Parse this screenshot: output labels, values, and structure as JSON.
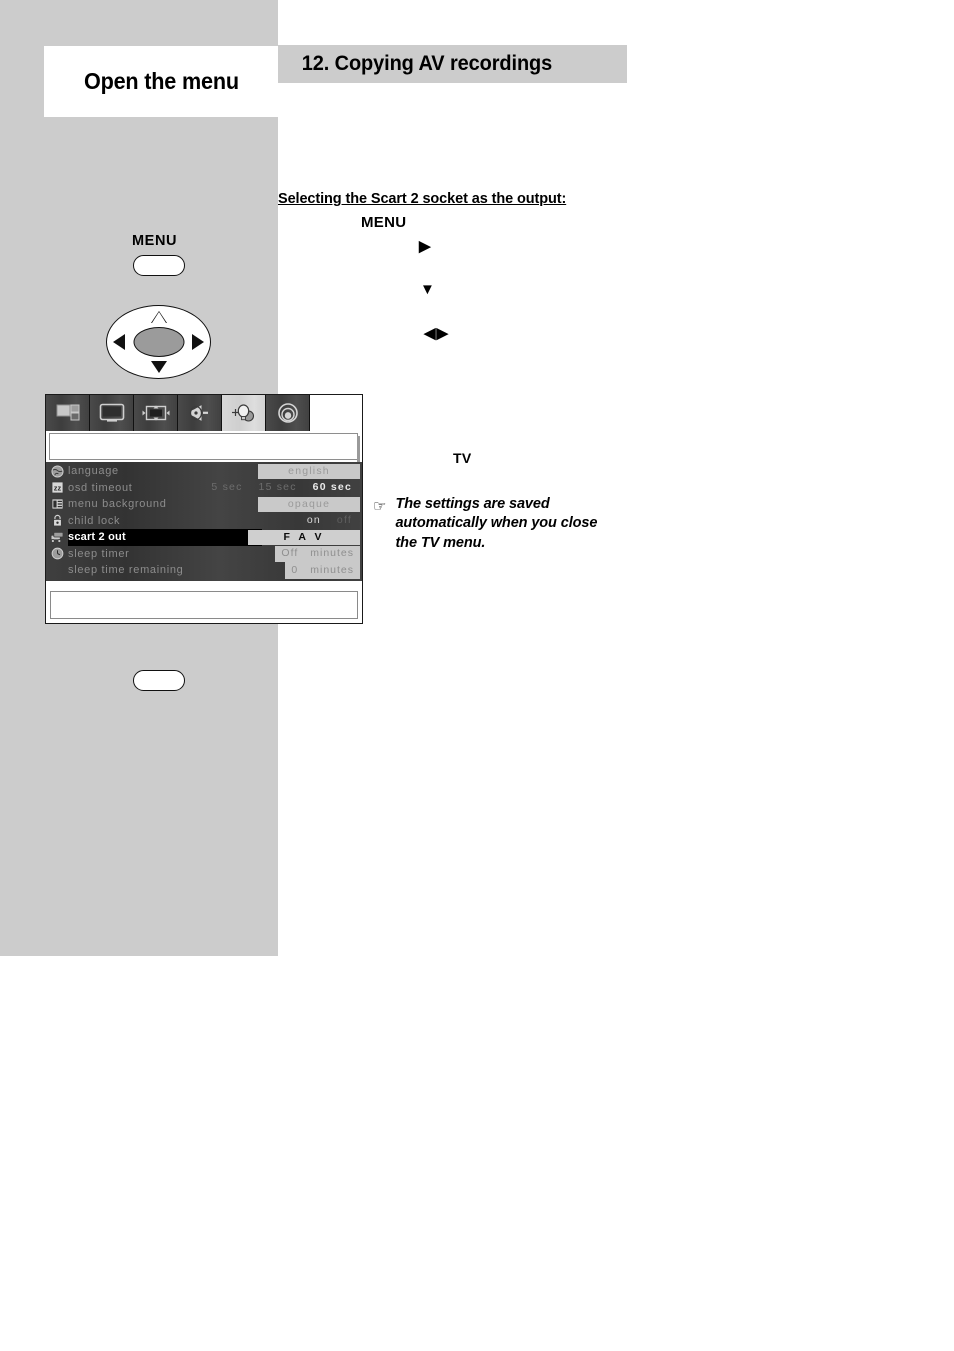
{
  "page": {
    "section_title": "Open the menu",
    "chapter_title": "12. Copying AV recordings"
  },
  "instructions": {
    "heading": "Selecting the Scart 2 socket as the output:",
    "steps": [
      {
        "key": "menu-step",
        "label": "MENU"
      },
      {
        "key": "right-step",
        "label": "▶"
      },
      {
        "key": "down-step",
        "label": "▼"
      },
      {
        "key": "left-right-step",
        "label": "◀▶"
      },
      {
        "key": "tv-step",
        "label": "TV"
      }
    ],
    "note": {
      "icon": "pointing-hand-icon",
      "glyph": "☞",
      "text": "The settings are saved automatically when you close the TV menu."
    }
  },
  "remote": {
    "menu_key_label": "MENU",
    "menu_button": "menu-button",
    "exit_button": "tv-exit-button",
    "dpad": {
      "up": "△",
      "down": "▼",
      "left": "◀",
      "right": "▶"
    }
  },
  "osd": {
    "tabs": [
      {
        "name": "picture-in-picture-tab",
        "selected": false
      },
      {
        "name": "picture-tab",
        "selected": false
      },
      {
        "name": "screen-format-tab",
        "selected": false
      },
      {
        "name": "sound-tab",
        "selected": false
      },
      {
        "name": "feature-settings-tab",
        "selected": true
      },
      {
        "name": "installation-tab",
        "selected": false
      }
    ],
    "rows": [
      {
        "icon": "globe-icon",
        "label": "language",
        "state": "dim",
        "values": [
          {
            "text": "english",
            "style": "plate"
          }
        ]
      },
      {
        "icon": "zz-timer-icon",
        "label": "osd timeout",
        "state": "dim",
        "values": [
          {
            "text": "5 sec",
            "style": "ghost"
          },
          {
            "text": "15 sec",
            "style": "ghost"
          },
          {
            "text": "60 sec",
            "style": "bright"
          }
        ]
      },
      {
        "icon": "menu-background-icon",
        "label": "menu background",
        "state": "dim",
        "values": [
          {
            "text": "opaque",
            "style": "plate"
          }
        ]
      },
      {
        "icon": "padlock-icon",
        "label": "child lock",
        "state": "dim",
        "values": [
          {
            "text": "on",
            "style": "onoff-on"
          },
          {
            "text": "off",
            "style": "onoff-off"
          }
        ]
      },
      {
        "icon": "scart-socket-icon",
        "label": "scart 2 out",
        "state": "selected",
        "values": [
          {
            "text": "F A V",
            "style": "plate-strong"
          }
        ]
      },
      {
        "icon": "sleep-clock-icon",
        "label": "sleep timer",
        "state": "dim",
        "values": [
          {
            "text": "Off",
            "style": "split-a"
          },
          {
            "text": "minutes",
            "style": "split-b"
          }
        ]
      },
      {
        "icon": "",
        "label": "sleep time remaining",
        "state": "dim",
        "values": [
          {
            "text": "0",
            "style": "split-a"
          },
          {
            "text": "minutes",
            "style": "split-b"
          }
        ]
      }
    ]
  },
  "colors": {
    "page_gray": "#cccccc",
    "osd_dark": "#3b3b3b",
    "osd_plate": "#c9c9c9",
    "selected_row": "#000000",
    "dpad_center": "#9b9b9b"
  }
}
